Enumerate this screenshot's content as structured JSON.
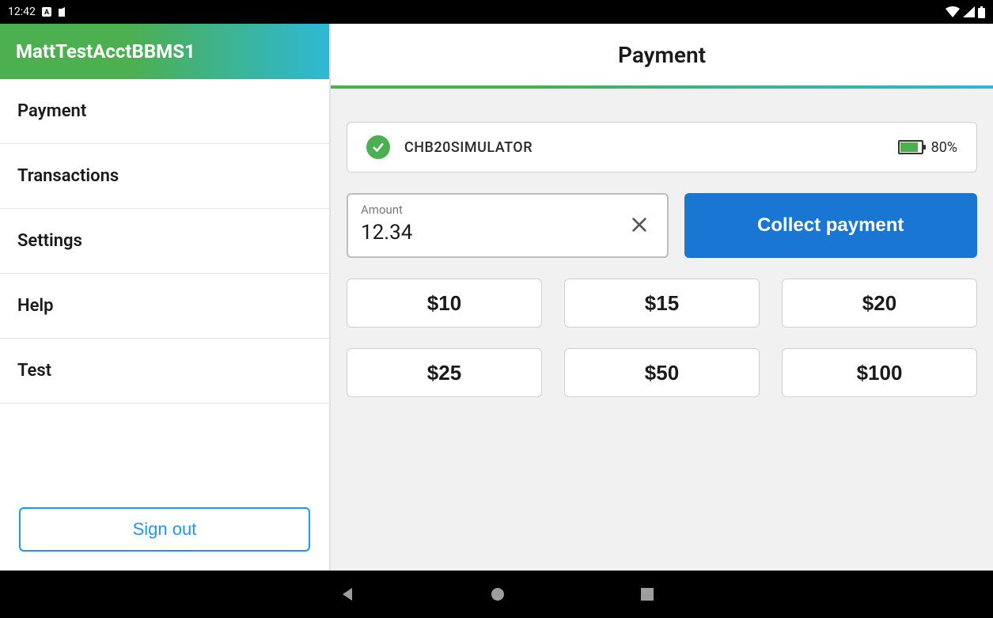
{
  "status_bar": {
    "time": "12:42"
  },
  "sidebar": {
    "account_name": "MattTestAcctBBMS1",
    "items": [
      {
        "label": "Payment"
      },
      {
        "label": "Transactions"
      },
      {
        "label": "Settings"
      },
      {
        "label": "Help"
      },
      {
        "label": "Test"
      }
    ],
    "signout_label": "Sign out"
  },
  "main": {
    "title": "Payment",
    "device": {
      "name": "CHB20SIMULATOR",
      "battery_pct": "80%"
    },
    "amount": {
      "label": "Amount",
      "value": "12.34"
    },
    "collect_label": "Collect payment",
    "presets": [
      "$10",
      "$15",
      "$20",
      "$25",
      "$50",
      "$100"
    ]
  }
}
